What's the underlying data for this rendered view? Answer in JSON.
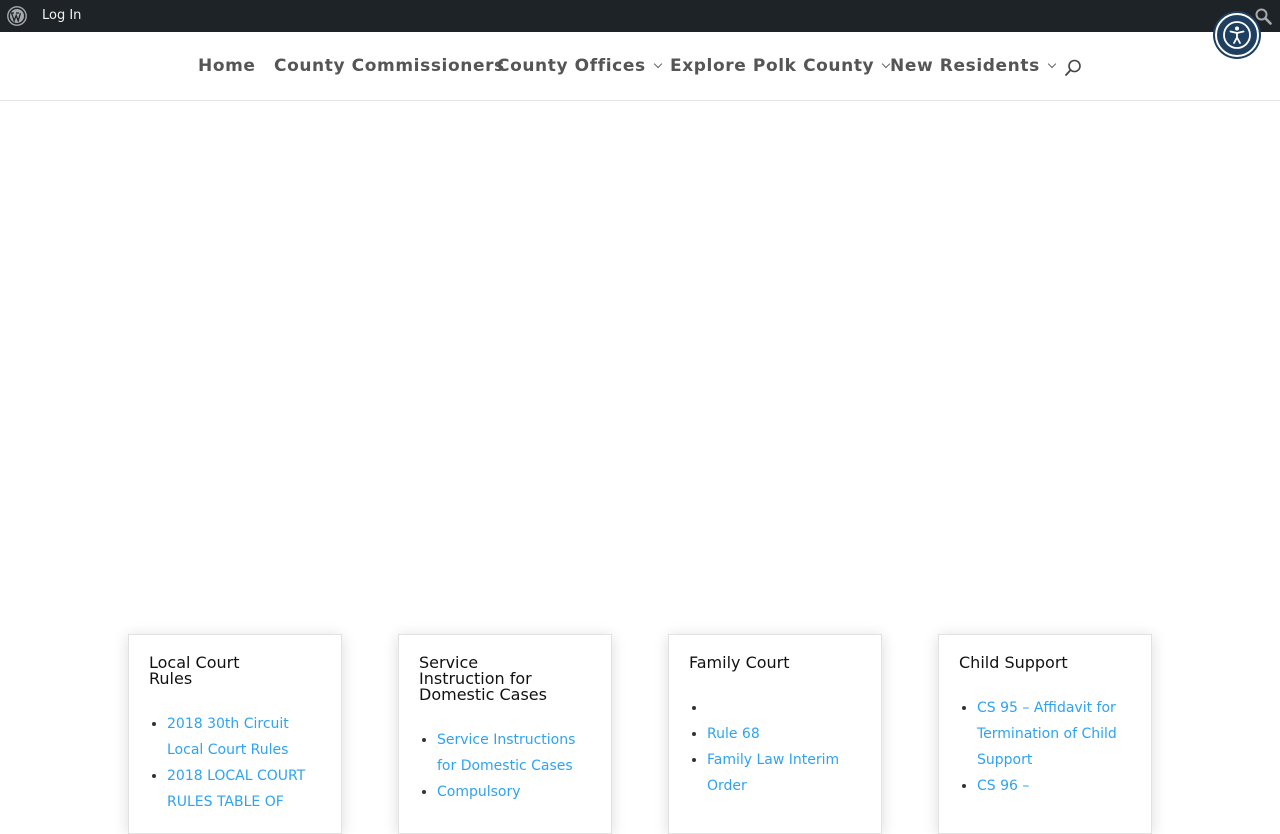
{
  "admin_bar": {
    "login_label": "Log In"
  },
  "nav": {
    "items": [
      {
        "label": "Home"
      },
      {
        "label": "County Commissioners"
      },
      {
        "label": "County Offices"
      },
      {
        "label": "Explore Polk County"
      },
      {
        "label": "New Residents"
      }
    ]
  },
  "cards": [
    {
      "title": "Local Court Rules",
      "links": [
        "2018 30th Circuit Local Court Rules",
        "2018 LOCAL COURT RULES TABLE OF"
      ]
    },
    {
      "title": "Service Instruction for Domestic Cases",
      "links": [
        "Service Instructions for Domestic Cases",
        "Compulsory"
      ]
    },
    {
      "title": "Family Court",
      "links": [
        "",
        "Rule 68",
        "Family Law Interim Order"
      ]
    },
    {
      "title": "Child Support",
      "links": [
        "CS 95 – Affidavit for Termination of Child Support",
        "CS 96 –"
      ]
    }
  ],
  "colors": {
    "admin_bar_bg": "#1d2327",
    "link": "#2ea3f2",
    "nav_text": "#555555",
    "a11y_button": "#1f3f60"
  },
  "icons": [
    "wordpress-logo-icon",
    "search-icon",
    "accessibility-icon",
    "chevron-down-icon"
  ]
}
